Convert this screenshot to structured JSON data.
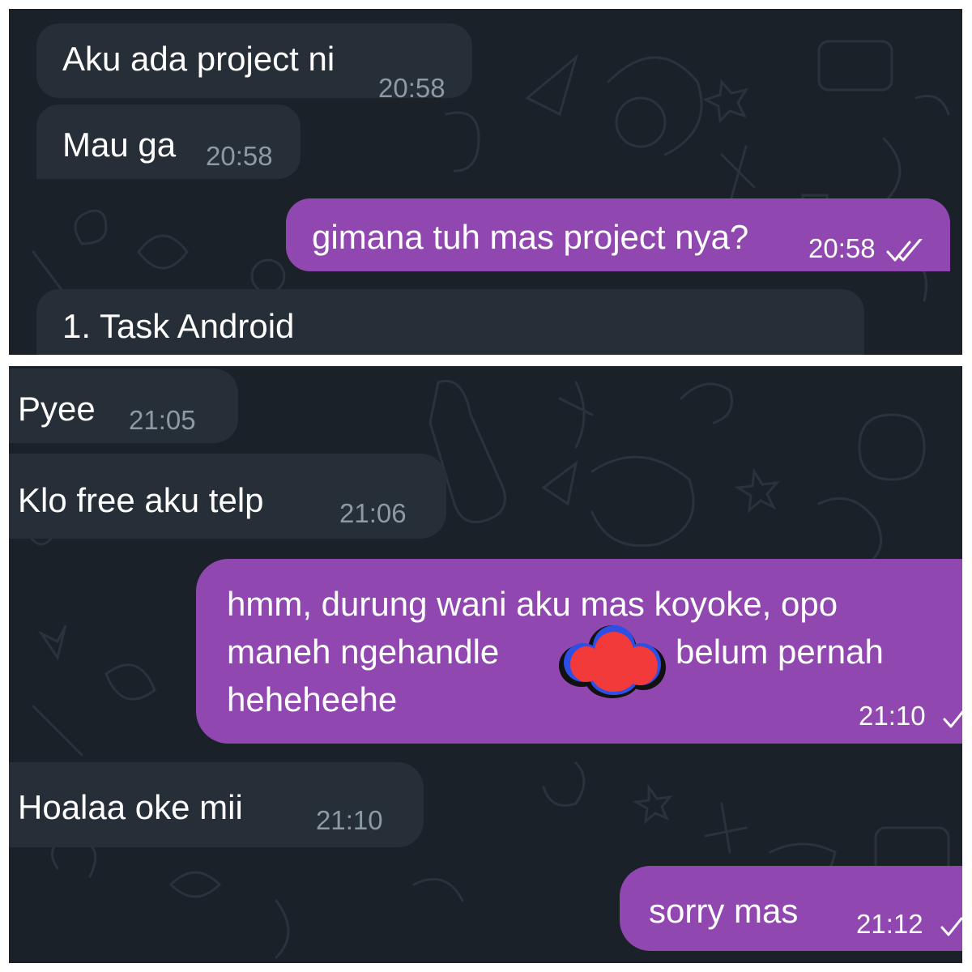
{
  "top_panel": {
    "messages": [
      {
        "direction": "incoming",
        "text": "Aku ada project ni",
        "time": "20:58"
      },
      {
        "direction": "incoming",
        "text": "Mau ga",
        "time": "20:58"
      },
      {
        "direction": "outgoing",
        "text": "gimana tuh mas project nya?",
        "time": "20:58",
        "status": "read"
      },
      {
        "direction": "incoming",
        "text": "1. Task Android",
        "time": ""
      }
    ]
  },
  "bottom_panel": {
    "messages": [
      {
        "direction": "incoming",
        "text": "Pyee",
        "time": "21:05"
      },
      {
        "direction": "incoming",
        "text": "Klo free aku telp",
        "time": "21:06"
      },
      {
        "direction": "outgoing",
        "lines": [
          "hmm, durung wani aku mas koyoke, opo",
          "maneh ngehandle",
          "belum pernah",
          "heheheehe"
        ],
        "time": "21:10",
        "status": "sent"
      },
      {
        "direction": "incoming",
        "text": "Hoalaa oke mii",
        "time": "21:10"
      },
      {
        "direction": "outgoing",
        "text": "sorry mas",
        "time": "21:12",
        "status": "sent"
      }
    ]
  },
  "colors": {
    "chat_background": "#1b2128",
    "incoming_bubble": "#262e37",
    "outgoing_bubble": "#9048b0",
    "incoming_time": "#8d99a4",
    "redaction_red": "#f23a3a",
    "redaction_blue": "#2d4fe6"
  },
  "icons": [
    "double-check-icon",
    "single-check-icon",
    "redaction-scribble"
  ]
}
